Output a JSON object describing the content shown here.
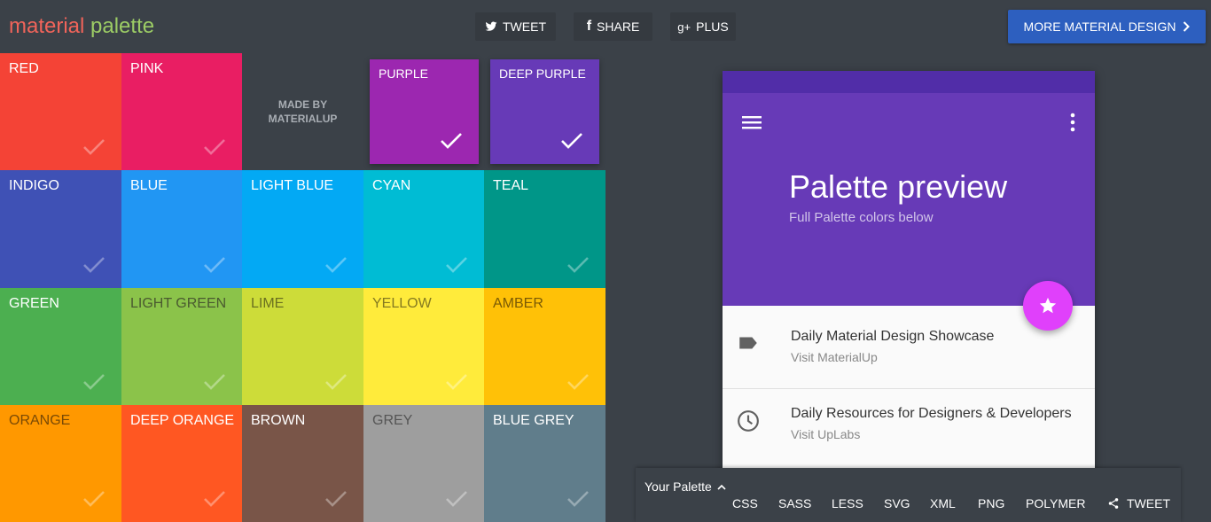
{
  "header": {
    "logo_word1": "material",
    "logo_word2": "palette",
    "tweet_label": "TWEET",
    "share_label": "SHARE",
    "plus_label": "PLUS",
    "more_label": "MORE MATERIAL DESIGN"
  },
  "made_by": {
    "line1": "MADE BY",
    "line2": "MATERIALUP"
  },
  "colors": [
    {
      "label": "RED",
      "color": "#f44336",
      "text": "#ffffff"
    },
    {
      "label": "PINK",
      "color": "#e91e63",
      "text": "#ffffff"
    },
    {
      "label": "PURPLE",
      "color": "#9c27b0",
      "text": "#ffffff",
      "selected": true
    },
    {
      "label": "DEEP PURPLE",
      "color": "#673ab7",
      "text": "#ffffff",
      "selected": true
    },
    {
      "label": "INDIGO",
      "color": "#3f51b5",
      "text": "#ffffff"
    },
    {
      "label": "BLUE",
      "color": "#2196f3",
      "text": "#ffffff"
    },
    {
      "label": "LIGHT BLUE",
      "color": "#03a9f4",
      "text": "#ffffff"
    },
    {
      "label": "CYAN",
      "color": "#00bcd4",
      "text": "#ffffff"
    },
    {
      "label": "TEAL",
      "color": "#009688",
      "text": "#ffffff"
    },
    {
      "label": "GREEN",
      "color": "#4caf50",
      "text": "#ffffff"
    },
    {
      "label": "LIGHT GREEN",
      "color": "#8bc34a",
      "text": "#4a5a30"
    },
    {
      "label": "LIME",
      "color": "#cddc39",
      "text": "#6a7020"
    },
    {
      "label": "YELLOW",
      "color": "#ffeb3b",
      "text": "#857a20"
    },
    {
      "label": "AMBER",
      "color": "#ffc107",
      "text": "#7a5a05"
    },
    {
      "label": "ORANGE",
      "color": "#ff9800",
      "text": "#7a4a05"
    },
    {
      "label": "DEEP ORANGE",
      "color": "#ff5722",
      "text": "#ffffff"
    },
    {
      "label": "BROWN",
      "color": "#795548",
      "text": "#ffffff"
    },
    {
      "label": "GREY",
      "color": "#9e9e9e",
      "text": "#555555"
    },
    {
      "label": "BLUE GREY",
      "color": "#607d8b",
      "text": "#ffffff"
    }
  ],
  "preview": {
    "status_color": "#512da8",
    "primary_color": "#673ab7",
    "accent_color": "#e040fb",
    "title": "Palette preview",
    "subtitle": "Full Palette colors below",
    "rows": [
      {
        "title": "Daily Material Design Showcase",
        "subtitle": "Visit MaterialUp",
        "icon": "label-icon"
      },
      {
        "title": "Daily Resources for Designers & Developers",
        "subtitle": "Visit UpLabs",
        "icon": "clock-icon"
      }
    ]
  },
  "palette_bar": {
    "title": "Your Palette",
    "formats": [
      "CSS",
      "SASS",
      "LESS",
      "SVG",
      "XML",
      "PNG",
      "POLYMER"
    ],
    "tweet_label": "TWEET"
  }
}
